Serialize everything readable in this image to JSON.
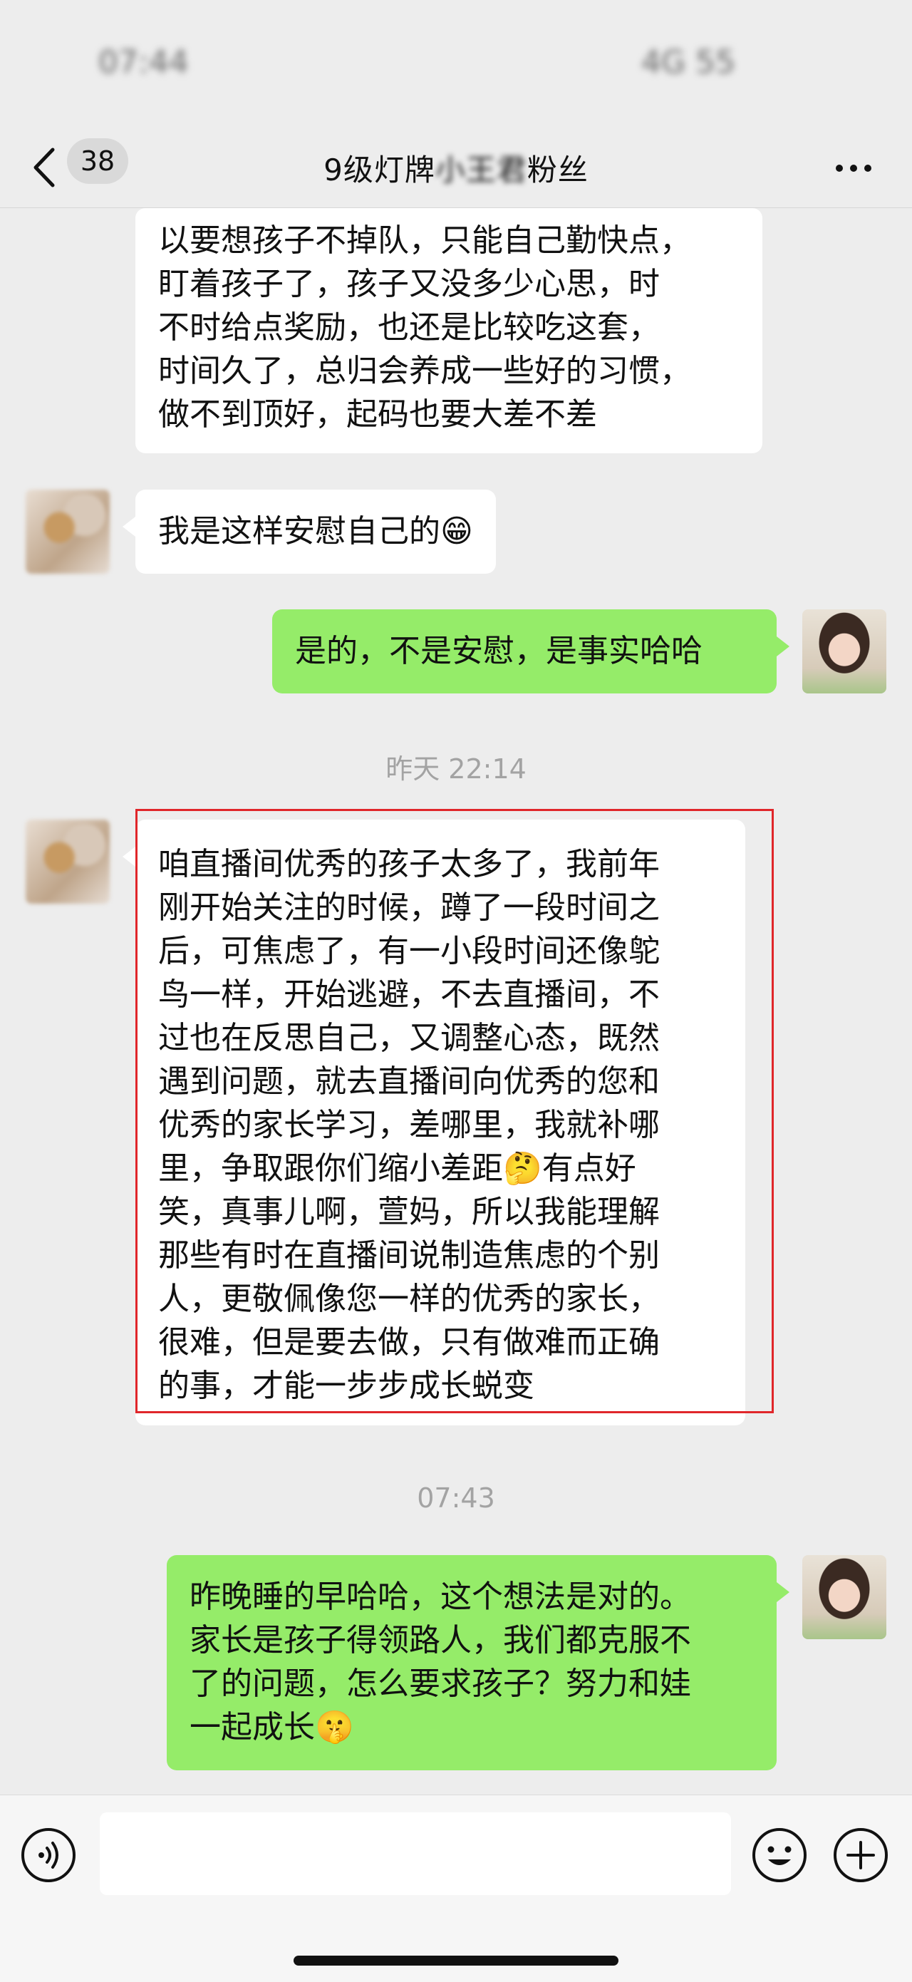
{
  "status_bar": {
    "time": "07:44",
    "icons": "4G 55"
  },
  "header": {
    "unread_count": "38",
    "title_prefix": "9级灯牌",
    "title_blurred": "小王君",
    "title_suffix": "粉丝"
  },
  "messages": [
    {
      "sender": "other",
      "lines": [
        "以要想孩子不掉队，只能自己勤快点，",
        "盯着孩子了，孩子又没多少心思，时",
        "不时给点奖励，也还是比较吃这套，",
        "时间久了，总归会养成一些好的习惯，",
        "做不到顶好，起码也要大差不差"
      ]
    },
    {
      "sender": "other",
      "lines": [
        "我是这样安慰自己的😁"
      ]
    },
    {
      "sender": "self",
      "lines": [
        "是的，不是安慰，是事实哈哈"
      ]
    },
    {
      "type": "time",
      "text": "昨天 22:14"
    },
    {
      "sender": "other",
      "highlighted": true,
      "lines": [
        "咱直播间优秀的孩子太多了，我前年",
        "刚开始关注的时候，蹲了一段时间之",
        "后，可焦虑了，有一小段时间还像鸵",
        "鸟一样，开始逃避，不去直播间，不",
        "过也在反思自己，又调整心态，既然",
        "遇到问题，就去直播间向优秀的您和",
        "优秀的家长学习，差哪里，我就补哪",
        "里，争取跟你们缩小差距🤔有点好",
        "笑，真事儿啊，萱妈，所以我能理解",
        "那些有时在直播间说制造焦虑的个别",
        "人，更敬佩像您一样的优秀的家长，",
        "很难，但是要去做，只有做难而正确",
        "的事，才能一步步成长蜕变"
      ]
    },
    {
      "type": "time",
      "text": "07:43"
    },
    {
      "sender": "self",
      "lines": [
        "昨晚睡的早哈哈，这个想法是对的。",
        "家长是孩子得领路人，我们都克服不",
        "了的问题，怎么要求孩子？努力和娃",
        "一起成长🤫"
      ]
    }
  ],
  "input": {
    "placeholder": ""
  },
  "colors": {
    "self_bubble": "#95ec69",
    "other_bubble": "#ffffff",
    "highlight": "#e0262a",
    "background": "#ededed"
  },
  "icons": [
    "chevron-left-icon",
    "more-icon",
    "voice-icon",
    "emoji-icon",
    "plus-icon"
  ]
}
